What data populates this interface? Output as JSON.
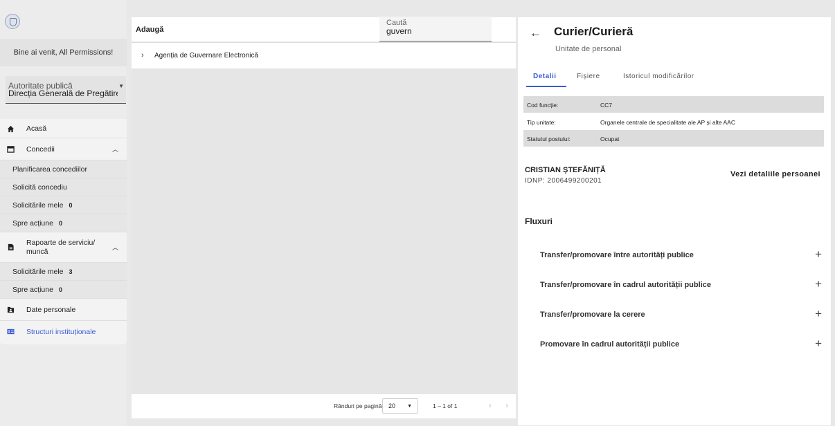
{
  "sidebar": {
    "welcome": "Bine ai venit, All Permissions!",
    "authority_label": "Autoritate publică",
    "authority_value": "Direcția Generală de Pregătire",
    "menu": [
      {
        "label": "Acasă"
      },
      {
        "label": "Concedii"
      },
      {
        "label": "Planificarea concediilor"
      },
      {
        "label": "Solicită concediu"
      },
      {
        "label": "Solicitările mele",
        "count": "0"
      },
      {
        "label": "Spre acțiune",
        "count": "0"
      },
      {
        "label": "Rapoarte de serviciu/",
        "label2": "muncă"
      },
      {
        "label": "Solicitările mele",
        "count": "3"
      },
      {
        "label": "Spre acțiune",
        "count": "0"
      },
      {
        "label": "Date personale"
      },
      {
        "label": "Structuri instituționale"
      }
    ]
  },
  "middle": {
    "add_label": "Adaugă",
    "search_label": "Caută",
    "search_value": "guvern",
    "tree_item": "Agenția de Guvernare Electronică",
    "paginator": {
      "rows_label": "Rânduri pe pagină",
      "page_size": "20",
      "range": "1 – 1 of 1"
    }
  },
  "detail": {
    "title": "Curier/Curieră",
    "subtitle": "Unitate de personal",
    "tabs": [
      "Detalii",
      "Fișiere",
      "Istoricul modificărilor"
    ],
    "rows": [
      {
        "key": "Cod funcție:",
        "value": "CC7"
      },
      {
        "key": "Tip unitate:",
        "value": "Organele centrale de specialitate ale AP și alte AAC"
      },
      {
        "key": "Statutul postului:",
        "value": "Ocupat"
      }
    ],
    "person": {
      "name": "CRISTIAN ȘTEFĂNIȚĂ",
      "idnp": "IDNP: 2006499200201",
      "link": "Vezi detaliile persoanei"
    },
    "flows_title": "Fluxuri",
    "flows": [
      "Transfer/promovare între autorități publice",
      "Transfer/promovare în cadrul autorității publice",
      "Transfer/promovare la cerere",
      "Promovare în cadrul autorității publice"
    ]
  },
  "colors": {
    "accent": "#3b5bd6",
    "background": "#e8e8e8",
    "panel": "#ffffff"
  }
}
